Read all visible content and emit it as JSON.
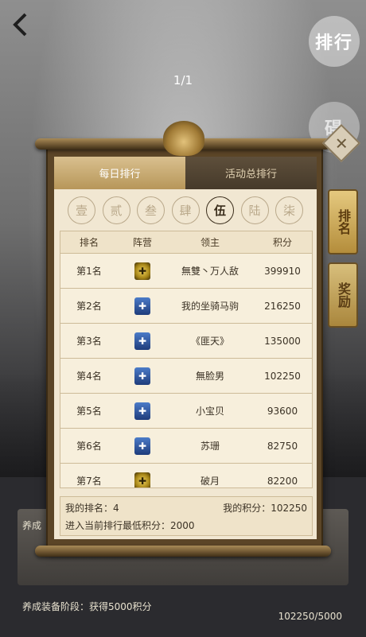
{
  "page_indicator": "1/1",
  "side_buttons": {
    "ranking": "排行",
    "top2": "碍"
  },
  "main_tabs": [
    {
      "label": "每日排行",
      "active": true
    },
    {
      "label": "活动总排行",
      "active": false
    }
  ],
  "rank_tabs": [
    {
      "label": "壹",
      "active": false
    },
    {
      "label": "贰",
      "active": false
    },
    {
      "label": "叁",
      "active": false
    },
    {
      "label": "肆",
      "active": false
    },
    {
      "label": "伍",
      "active": true
    },
    {
      "label": "陆",
      "active": false
    },
    {
      "label": "柒",
      "active": false
    }
  ],
  "table": {
    "headers": [
      "排名",
      "阵营",
      "领主",
      "积分"
    ],
    "rows": [
      {
        "rank": "第1名",
        "faction": "gold",
        "name": "無雙丶万人敌",
        "score": "399910"
      },
      {
        "rank": "第2名",
        "faction": "blue",
        "name": "我的坐骑马驹",
        "score": "216250"
      },
      {
        "rank": "第3名",
        "faction": "blue",
        "name": "《匪天》",
        "score": "135000"
      },
      {
        "rank": "第4名",
        "faction": "blue",
        "name": "無脸男",
        "score": "102250"
      },
      {
        "rank": "第5名",
        "faction": "blue",
        "name": "小宝贝",
        "score": "93600"
      },
      {
        "rank": "第6名",
        "faction": "blue",
        "name": "苏珊",
        "score": "82750"
      },
      {
        "rank": "第7名",
        "faction": "gold",
        "name": "破月",
        "score": "82200"
      }
    ]
  },
  "summary": {
    "my_rank": "我的排名：4",
    "my_score": "我的积分：102250",
    "min_score": "进入当前排行最低积分：2000"
  },
  "side_tabs": [
    {
      "label": "排名"
    },
    {
      "label": "奖励"
    }
  ],
  "bottom": {
    "label_1": "养成",
    "label_2": "养成装备阶段：获得5000积分",
    "progress_2": "102250/5000"
  },
  "colors": {
    "active_tab": "#c9a86c",
    "paper": "#f1e7d2",
    "frame": "#5b4527",
    "faction_gold": "#d4b43a",
    "faction_blue": "#2e5aa8"
  },
  "icons": {
    "back": "back-arrow-icon",
    "close": "close-icon",
    "ornament": "dragon-ornament-icon"
  }
}
